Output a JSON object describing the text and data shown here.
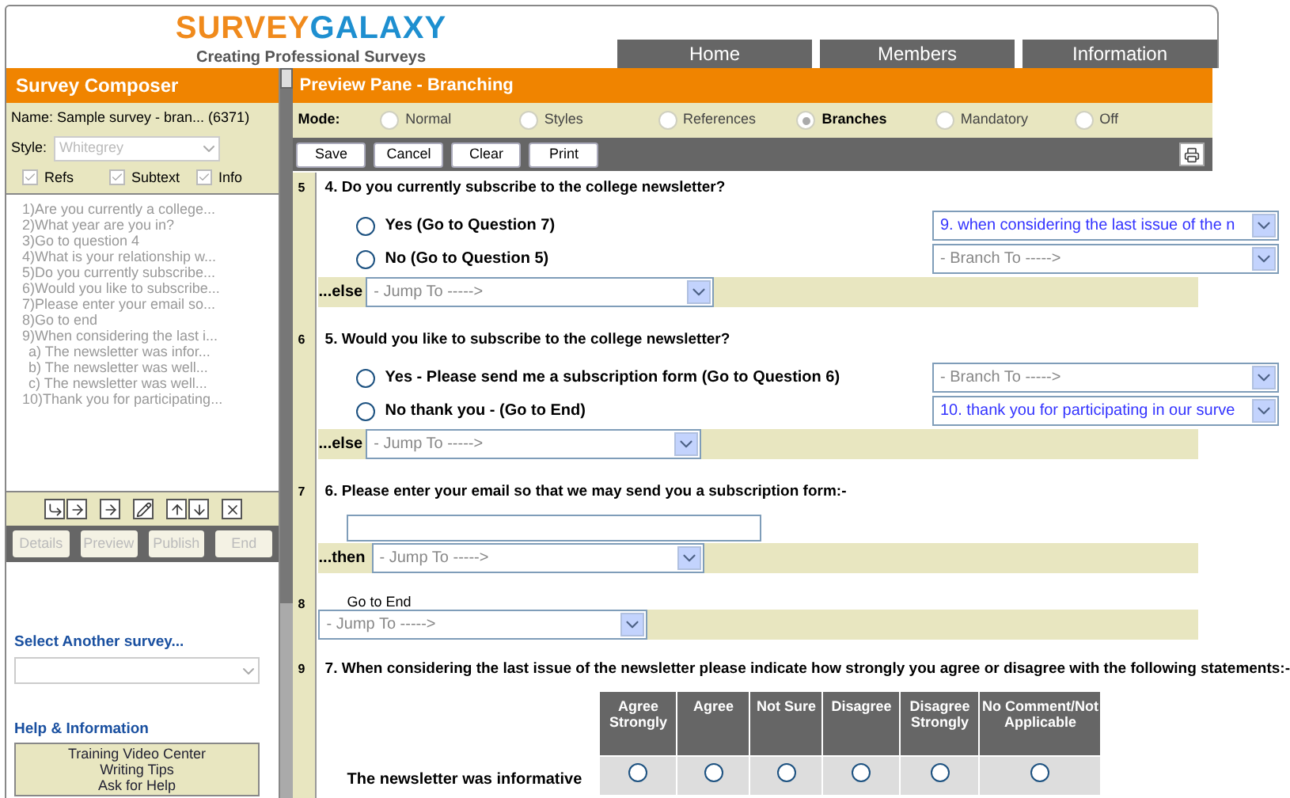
{
  "logo": {
    "brand_first": "SURVEY",
    "brand_second": "GALAXY",
    "tagline": "Creating Professional Surveys"
  },
  "nav_tabs": [
    {
      "label": "Home"
    },
    {
      "label": "Members"
    },
    {
      "label": "Information"
    }
  ],
  "composer": {
    "title": "Survey Composer",
    "name": "Name: Sample survey - bran... (6371)",
    "style_label": "Style:",
    "style_value": "Whitegrey",
    "options": [
      {
        "label": "Refs",
        "checked": true
      },
      {
        "label": "Subtext",
        "checked": true
      },
      {
        "label": "Info",
        "checked": true
      }
    ],
    "outline": [
      {
        "text": "1)Are you currently a college..."
      },
      {
        "text": "2)What year are you in?"
      },
      {
        "text": "3)Go to question 4"
      },
      {
        "text": "4)What is your relationship w..."
      },
      {
        "text": "5)Do you currently subscribe..."
      },
      {
        "text": "6)Would you like to subscribe..."
      },
      {
        "text": "7)Please enter your email so..."
      },
      {
        "text": "8)Go to end"
      },
      {
        "text": "9)When considering the last i...",
        "children": [
          {
            "text": "a) The newsletter was infor..."
          },
          {
            "text": "b) The newsletter was well..."
          },
          {
            "text": "c) The newsletter was well..."
          }
        ]
      },
      {
        "text": "10)Thank you for participating..."
      }
    ],
    "actions": [
      {
        "label": "Details",
        "disabled": true
      },
      {
        "label": "Preview",
        "disabled": true
      },
      {
        "label": "Publish",
        "disabled": true
      },
      {
        "label": "End",
        "disabled": true
      }
    ],
    "select_survey_label": "Select Another survey...",
    "help": {
      "title": "Help & Information",
      "links": [
        "Training Video Center",
        "Writing Tips",
        "Ask for Help"
      ]
    }
  },
  "preview": {
    "title": "Preview Pane - Branching",
    "mode_label": "Mode:",
    "modes": [
      {
        "label": "Normal",
        "selected": false
      },
      {
        "label": "Styles",
        "selected": false
      },
      {
        "label": "References",
        "selected": false
      },
      {
        "label": "Branches",
        "selected": true
      },
      {
        "label": "Mandatory",
        "selected": false
      },
      {
        "label": "Off",
        "selected": false
      }
    ],
    "buttons": [
      "Save",
      "Cancel",
      "Clear",
      "Print"
    ]
  },
  "rows": [
    {
      "line": "5",
      "kind": "choice",
      "number": "4.",
      "question": "Do you currently subscribe to the college newsletter?",
      "options": [
        {
          "label": "Yes (Go to Question 7)",
          "selected": false,
          "branch": "9. when considering the last issue of the n",
          "branch_set": true
        },
        {
          "label": "No (Go to Question 5)",
          "selected": false,
          "branch": "- Branch To ----->",
          "branch_set": false
        }
      ],
      "fallback_label": "...else",
      "jump": "- Jump To ----->"
    },
    {
      "line": "6",
      "kind": "choice",
      "number": "5.",
      "question": "Would you like to subscribe to the college newsletter?",
      "options": [
        {
          "label": "Yes - Please send me a subscription form (Go to Question 6)",
          "selected": false,
          "branch": "- Branch To ----->",
          "branch_set": false
        },
        {
          "label": "No thank you - (Go to End)",
          "selected": false,
          "branch": "10. thank you for participating in our surve",
          "branch_set": true
        }
      ],
      "fallback_label": "...else",
      "jump": "- Jump To ----->"
    },
    {
      "line": "7",
      "kind": "text",
      "number": "6.",
      "question": "Please enter your email so that we may send you a subscription form:-",
      "fallback_label": "...then",
      "jump": "- Jump To ----->"
    },
    {
      "line": "8",
      "kind": "end",
      "text": "Go to End",
      "jump": "- Jump To ----->"
    },
    {
      "line": "9",
      "kind": "matrix",
      "number": "7.",
      "question": "When considering the last issue of the newsletter please indicate how strongly you agree or disagree with the following statements:-",
      "columns": [
        "Agree Strongly",
        "Agree",
        "Not Sure",
        "Disagree",
        "Disagree Strongly",
        "No Comment/Not Applicable"
      ],
      "statements": [
        {
          "label": "The newsletter was informative",
          "answers": [
            {
              "selected": false
            },
            {
              "selected": false
            },
            {
              "selected": false
            },
            {
              "selected": false
            },
            {
              "selected": false
            },
            {
              "selected": false
            }
          ]
        }
      ]
    }
  ]
}
